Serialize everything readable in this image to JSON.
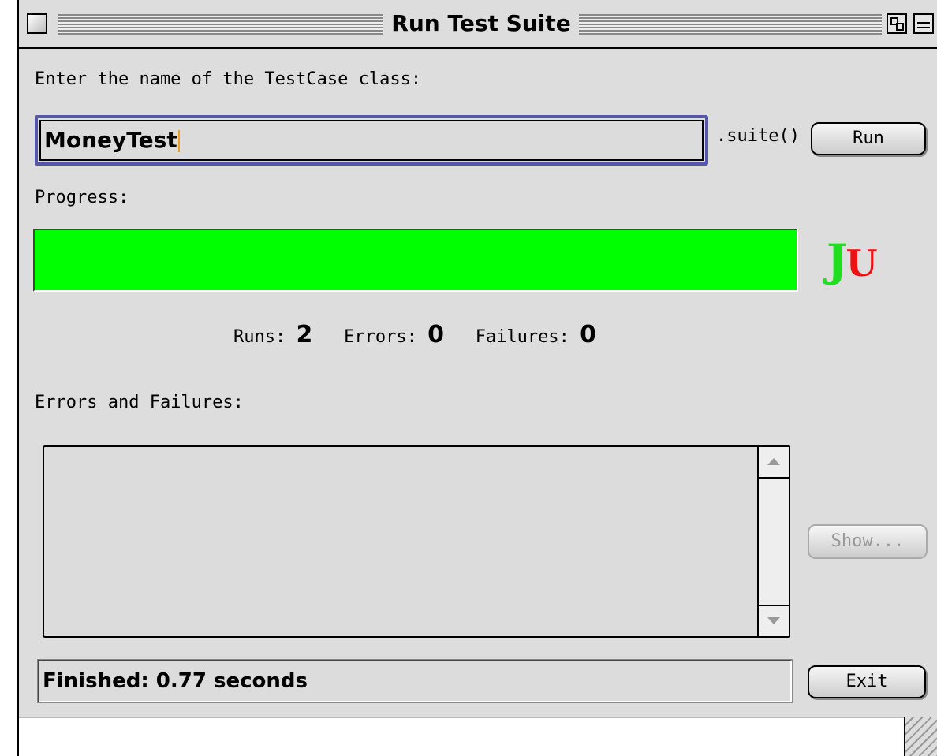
{
  "window": {
    "title": "Run Test Suite"
  },
  "form": {
    "class_prompt": "Enter the name of the TestCase class:",
    "class_value": "MoneyTest",
    "suite_suffix": ".suite()",
    "run_label": "Run"
  },
  "progress": {
    "label": "Progress:",
    "fraction": 1.0,
    "bar_color": "#00ff00",
    "logo_j": "J",
    "logo_u": "U",
    "logo_j_color": "#22dd22",
    "logo_u_color": "#ee1111"
  },
  "counters": {
    "runs_label": "Runs:",
    "runs_value": "2",
    "errors_label": "Errors:",
    "errors_value": "0",
    "failures_label": "Failures:",
    "failures_value": "0"
  },
  "errors_panel": {
    "label": "Errors and Failures:",
    "items": [],
    "show_label": "Show..."
  },
  "status": {
    "text": "Finished: 0.77 seconds"
  },
  "footer": {
    "exit_label": "Exit"
  }
}
